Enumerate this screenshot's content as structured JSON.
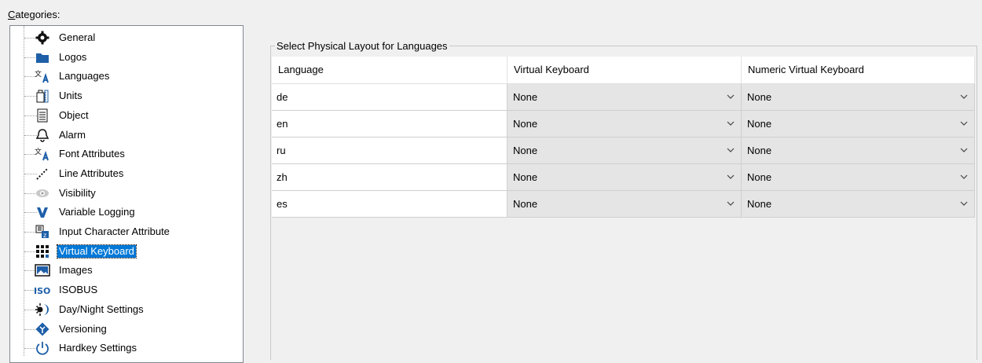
{
  "categories_label": {
    "accel": "C",
    "rest": "ategories:"
  },
  "tree": {
    "items": [
      {
        "label": "General",
        "icon": "gear-icon"
      },
      {
        "label": "Logos",
        "icon": "logo-icon"
      },
      {
        "label": "Languages",
        "icon": "languages-icon"
      },
      {
        "label": "Units",
        "icon": "units-icon"
      },
      {
        "label": "Object",
        "icon": "object-icon"
      },
      {
        "label": "Alarm",
        "icon": "bell-icon"
      },
      {
        "label": "Font Attributes",
        "icon": "font-icon"
      },
      {
        "label": "Line Attributes",
        "icon": "line-icon"
      },
      {
        "label": "Visibility",
        "icon": "eye-icon"
      },
      {
        "label": "Variable Logging",
        "icon": "v-icon"
      },
      {
        "label": "Input Character Attribute",
        "icon": "input-char-icon"
      },
      {
        "label": "Virtual Keyboard",
        "icon": "keyboard-icon",
        "selected": true
      },
      {
        "label": "Images",
        "icon": "image-icon"
      },
      {
        "label": "ISOBUS",
        "icon": "iso-icon"
      },
      {
        "label": "Day/Night Settings",
        "icon": "day-night-icon"
      },
      {
        "label": "Versioning",
        "icon": "versioning-icon"
      },
      {
        "label": "Hardkey Settings",
        "icon": "power-icon"
      }
    ]
  },
  "group": {
    "title": "Select Physical Layout for Languages",
    "columns": [
      "Language",
      "Virtual Keyboard",
      "Numeric Virtual Keyboard"
    ],
    "rows": [
      {
        "language": "de",
        "virtual_keyboard": "None",
        "numeric_virtual_keyboard": "None"
      },
      {
        "language": "en",
        "virtual_keyboard": "None",
        "numeric_virtual_keyboard": "None"
      },
      {
        "language": "ru",
        "virtual_keyboard": "None",
        "numeric_virtual_keyboard": "None"
      },
      {
        "language": "zh",
        "virtual_keyboard": "None",
        "numeric_virtual_keyboard": "None"
      },
      {
        "language": "es",
        "virtual_keyboard": "None",
        "numeric_virtual_keyboard": "None"
      }
    ]
  },
  "colors": {
    "selection": "#0078d7",
    "combo_bg": "#e5e5e5"
  }
}
